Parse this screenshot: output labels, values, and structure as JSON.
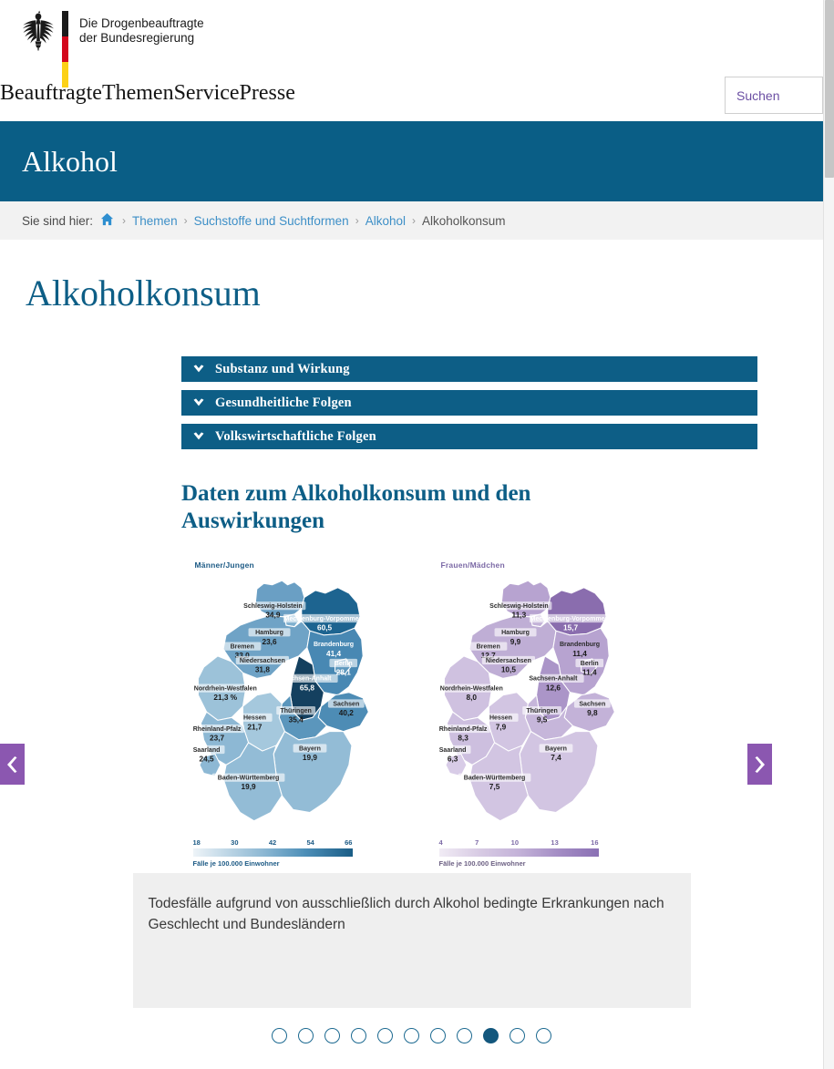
{
  "header": {
    "logo": {
      "eagle_icon": "bundesadler-icon",
      "flag_colors": [
        "#1a1a1a",
        "#d4071c",
        "#fcd116"
      ],
      "line1": "Die Drogenbeauftragte",
      "line2": "der Bundesregierung"
    },
    "nav": [
      {
        "label": "Beauftragte"
      },
      {
        "label": "Themen"
      },
      {
        "label": "Service"
      },
      {
        "label": "Presse"
      }
    ],
    "search": {
      "placeholder": "Suchen",
      "value": ""
    }
  },
  "banner": {
    "title": "Alkohol",
    "bg_color": "#0a5e86"
  },
  "breadcrumb": {
    "lead": "Sie sind hier:",
    "home_icon": "home-icon",
    "items": [
      {
        "label": "Themen",
        "current": false
      },
      {
        "label": "Suchstoffe und Suchtformen",
        "current": false
      },
      {
        "label": "Alkohol",
        "current": false
      },
      {
        "label": "Alkoholkonsum",
        "current": true
      }
    ],
    "separator": "›"
  },
  "main": {
    "page_title": "Alkoholkonsum",
    "accordion": [
      {
        "label": "Substanz und Wirkung",
        "icon": "chevron-down-icon"
      },
      {
        "label": "Gesundheitliche Folgen",
        "icon": "chevron-down-icon"
      },
      {
        "label": "Volkswirtschaftliche Folgen",
        "icon": "chevron-down-icon"
      }
    ],
    "section_title": "Daten zum Alkoholkonsum und den Auswirkungen",
    "carousel": {
      "prev_label": "‹",
      "next_label": "›",
      "prev_icon": "chevron-left-icon",
      "next_icon": "chevron-right-icon",
      "arrow_color": "#8b57b0",
      "caption": "Todesfälle aufgrund von ausschließlich durch Alkohol bedingte Erkrankungen nach Geschlecht und Bundesländern",
      "dot_count": 11,
      "active_dot": 9
    }
  },
  "chart_data": {
    "type": "map",
    "title": "Todesfälle aufgrund von ausschließlich durch Alkohol bedingte Erkrankungen nach Geschlecht und Bundesländern",
    "unit_label": "Fälle je 100.000 Einwohner",
    "panels": [
      {
        "name": "Männer/Jungen",
        "accent": "#1c5a85",
        "legend": {
          "ticks": [
            "18",
            "30",
            "42",
            "54",
            "66"
          ],
          "min": 18,
          "max": 66,
          "note": "Fälle je 100.000 Einwohner"
        },
        "regions": [
          {
            "id": "SH",
            "label": "Schleswig-Holstein",
            "value": "34,9",
            "num": 34.9,
            "fill": "#6a9fc4",
            "light": false
          },
          {
            "id": "MV",
            "label": "Mecklenburg-Vorpommern",
            "value": "60,5",
            "num": 60.5,
            "fill": "#1d6490",
            "light": true
          },
          {
            "id": "HH",
            "label": "Hamburg",
            "value": "23,6",
            "num": 23.6,
            "fill": "#7fb0cf",
            "light": false
          },
          {
            "id": "HB",
            "label": "Bremen",
            "value": "33,0",
            "num": 33.0,
            "fill": "#6a9fc4",
            "light": false
          },
          {
            "id": "NI",
            "label": "Niedersachsen",
            "value": "31,8",
            "num": 31.8,
            "fill": "#6fa3c6",
            "light": false
          },
          {
            "id": "BB",
            "label": "Brandenburg",
            "value": "41,4",
            "num": 41.4,
            "fill": "#4888b3",
            "light": true
          },
          {
            "id": "BE",
            "label": "Berlin",
            "value": "28,1",
            "num": 28.1,
            "fill": "#5c97bd",
            "light": false
          },
          {
            "id": "ST",
            "label": "Sachsen-Anhalt",
            "value": "65,8",
            "num": 65.8,
            "fill": "#14405f",
            "light": true
          },
          {
            "id": "NW",
            "label": "Nordrhein-Westfalen",
            "value": "21,3 %",
            "num": 21.3,
            "fill": "#9cc2d9",
            "light": false
          },
          {
            "id": "SN",
            "label": "Sachsen",
            "value": "40,2",
            "num": 40.2,
            "fill": "#4d8cb5",
            "light": false
          },
          {
            "id": "TH",
            "label": "Thüringen",
            "value": "35,4",
            "num": 35.4,
            "fill": "#5b96bc",
            "light": false
          },
          {
            "id": "HE",
            "label": "Hessen",
            "value": "21,7",
            "num": 21.7,
            "fill": "#a5c8dd",
            "light": false
          },
          {
            "id": "RP",
            "label": "Rheinland-Pfalz",
            "value": "23,7",
            "num": 23.7,
            "fill": "#8db8d4",
            "light": false
          },
          {
            "id": "SL",
            "label": "Saarland",
            "value": "24,5",
            "num": 24.5,
            "fill": "#8db8d4",
            "light": false
          },
          {
            "id": "BY",
            "label": "Bayern",
            "value": "19,9",
            "num": 19.9,
            "fill": "#93bcd6",
            "light": false
          },
          {
            "id": "BW",
            "label": "Baden-Württemberg",
            "value": "19,9",
            "num": 19.9,
            "fill": "#93bcd6",
            "light": false
          }
        ]
      },
      {
        "name": "Frauen/Mädchen",
        "accent": "#7c6aa6",
        "legend": {
          "ticks": [
            "4",
            "7",
            "10",
            "13",
            "16"
          ],
          "min": 4,
          "max": 16,
          "note": "Fälle je 100.000 Einwohner"
        },
        "regions": [
          {
            "id": "SH",
            "label": "Schleswig-Holstein",
            "value": "11,3",
            "num": 11.3,
            "fill": "#b7a3d0",
            "light": false
          },
          {
            "id": "MV",
            "label": "Mecklenburg-Vorpommern",
            "value": "15,7",
            "num": 15.7,
            "fill": "#8a6dae",
            "light": true
          },
          {
            "id": "HH",
            "label": "Hamburg",
            "value": "9,9",
            "num": 9.9,
            "fill": "#c3b2d8",
            "light": false
          },
          {
            "id": "HB",
            "label": "Bremen",
            "value": "12,7",
            "num": 12.7,
            "fill": "#b09ccb",
            "light": false
          },
          {
            "id": "NI",
            "label": "Niedersachsen",
            "value": "10,5",
            "num": 10.5,
            "fill": "#bfaed5",
            "light": false
          },
          {
            "id": "BB",
            "label": "Brandenburg",
            "value": "11,4",
            "num": 11.4,
            "fill": "#b7a3d0",
            "light": false
          },
          {
            "id": "BE",
            "label": "Berlin",
            "value": "11,4",
            "num": 11.4,
            "fill": "#b7a3d0",
            "light": false
          },
          {
            "id": "ST",
            "label": "Sachsen-Anhalt",
            "value": "12,6",
            "num": 12.6,
            "fill": "#ab95c8",
            "light": false
          },
          {
            "id": "NW",
            "label": "Nordrhein-Westfalen",
            "value": "8,0",
            "num": 8.0,
            "fill": "#cfc1e0",
            "light": false
          },
          {
            "id": "SN",
            "label": "Sachsen",
            "value": "9,8",
            "num": 9.8,
            "fill": "#c3b2d8",
            "light": false
          },
          {
            "id": "TH",
            "label": "Thüringen",
            "value": "9,5",
            "num": 9.5,
            "fill": "#c6b6da",
            "light": false
          },
          {
            "id": "HE",
            "label": "Hessen",
            "value": "7,9",
            "num": 7.9,
            "fill": "#d2c5e2",
            "light": false
          },
          {
            "id": "RP",
            "label": "Rheinland-Pfalz",
            "value": "8,3",
            "num": 8.3,
            "fill": "#cdbfdf",
            "light": false
          },
          {
            "id": "SL",
            "label": "Saarland",
            "value": "6,3",
            "num": 6.3,
            "fill": "#d8cce7",
            "light": false
          },
          {
            "id": "BY",
            "label": "Bayern",
            "value": "7,4",
            "num": 7.4,
            "fill": "#d2c5e2",
            "light": false
          },
          {
            "id": "BW",
            "label": "Baden-Württemberg",
            "value": "7,5",
            "num": 7.5,
            "fill": "#d2c5e2",
            "light": false
          }
        ]
      }
    ]
  }
}
